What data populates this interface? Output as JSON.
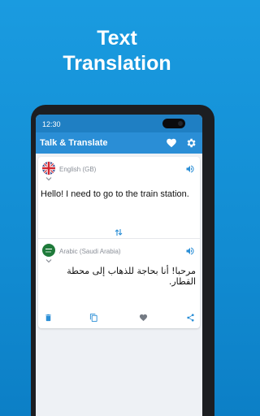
{
  "promo": {
    "headline_line1": "Text",
    "headline_line2": "Translation"
  },
  "status_bar": {
    "time": "12:30"
  },
  "app_bar": {
    "title": "Talk & Translate",
    "icons": [
      "heart-icon",
      "gear-icon"
    ]
  },
  "source": {
    "language": "English (GB)",
    "flag": "uk-flag",
    "text": "Hello! I need to go to the train station."
  },
  "target": {
    "language": "Arabic (Saudi Arabia)",
    "flag": "saudi-arabia-flag",
    "text": "مرحبا! أنا بحاجة للذهاب إلى محطة القطار."
  },
  "actions": [
    "delete-icon",
    "copy-icon",
    "favorite-icon",
    "share-icon"
  ],
  "colors": {
    "background": "#1a9be0",
    "app_bar": "#2a8ed6",
    "status_bar": "#1f7fc3",
    "accent": "#2a8ed6"
  }
}
